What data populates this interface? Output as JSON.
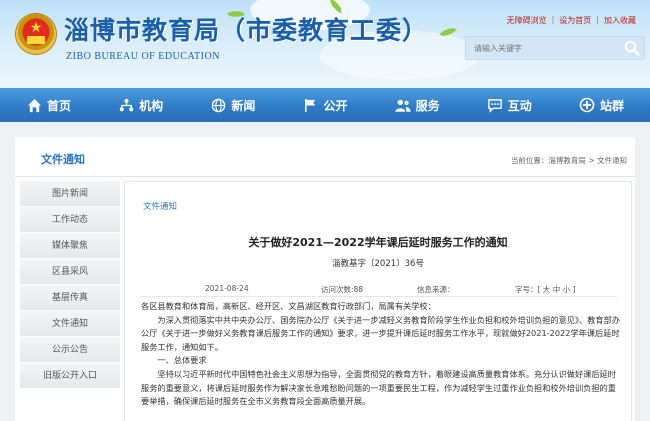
{
  "header": {
    "title": "淄博市教育局（市委教育工委）",
    "subtitle": "ZIBO BUREAU OF EDUCATION",
    "top_links": [
      "无障碍浏览",
      "设为首页",
      "加入收藏"
    ],
    "search_placeholder": "请输入关键字"
  },
  "nav": {
    "items": [
      {
        "label": "首页",
        "icon": "home-icon"
      },
      {
        "label": "机构",
        "icon": "org-icon"
      },
      {
        "label": "新闻",
        "icon": "globe-icon"
      },
      {
        "label": "公开",
        "icon": "flag-icon"
      },
      {
        "label": "服务",
        "icon": "users-icon"
      },
      {
        "label": "互动",
        "icon": "chat-icon"
      },
      {
        "label": "站群",
        "icon": "sites-icon"
      }
    ]
  },
  "panel": {
    "title": "文件通知",
    "breadcrumb": "当前位置：淄博教育局 > 文件通知"
  },
  "sidebar": {
    "items": [
      "图片新闻",
      "工作动态",
      "媒体聚焦",
      "区县采风",
      "基层传真",
      "文件通知",
      "公示公告",
      "旧版公开入口"
    ]
  },
  "article": {
    "section": "文件通知",
    "title": "关于做好2021—2022学年课后延时服务工作的通知",
    "doc_no": "淄教基字〔2021〕36号",
    "date": "2021-08-24",
    "views": "访问次数:88",
    "source": "信息来源：",
    "font_size": "字号：[ 大 中 小 ]",
    "paragraphs": [
      "各区县教育和体育局，高新区、经开区、文昌湖区教育行政部门，局属有关学校：",
      "为深入贯彻落实中共中央办公厅、国务院办公厅《关于进一步减轻义务教育阶段学生作业负担和校外培训负担的意见》、教育部办公厅《关于进一步做好义务教育课后服务工作的通知》要求，进一步提升课后延时服务工作水平，现就做好2021-2022学年课后延时服务工作，通知如下。",
      "一、总体要求",
      "坚持以习近平新时代中国特色社会主义思想为指导，全面贯彻党的教育方针，着眼建设高质量教育体系。充分认识做好课后延时服务的重要意义，将课后延时服务作为解决家长急难愁盼问题的一项重要民生工程，作为减轻学生过重作业负担和校外培训负担的重要举措，确保课后延时服务在全市义务教育段全面高质量开展。"
    ]
  }
}
